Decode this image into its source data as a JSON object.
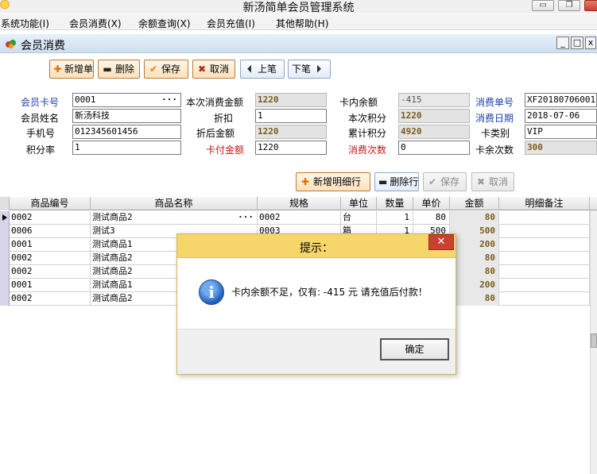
{
  "window": {
    "title": "新汤简单会员管理系统",
    "minimize": "▭",
    "restore": "❐",
    "close": "✕"
  },
  "menu": [
    "系统功能(I)",
    "会员消费(X)",
    "余额查询(X)",
    "会员充值(I)",
    "其他帮助(H)"
  ],
  "form": {
    "title": "会员消费",
    "min": "_",
    "max": "□",
    "close": "x"
  },
  "toolbar": {
    "new": "新增单",
    "delete": "删除",
    "save": "保存",
    "cancel": "取消",
    "prev": "上笔",
    "next": "下笔"
  },
  "fields": {
    "card_no_label": "会员卡号",
    "card_no": "0001",
    "name_label": "会员姓名",
    "name": "新汤科技",
    "phone_label": "手机号",
    "phone": "012345601456",
    "rate_label": "积分率",
    "rate": "1",
    "amount_label": "本次消费金额",
    "amount": "1220",
    "discount_label": "折扣",
    "discount": "1",
    "after_discount_label": "折后金额",
    "after_discount": "1220",
    "card_pay_label": "卡付金额",
    "card_pay": "1220",
    "balance_label": "卡内余额",
    "balance": "-415",
    "points_label": "本次积分",
    "points": "1220",
    "total_points_label": "累计积分",
    "total_points": "4920",
    "times_label": "消费次数",
    "times": "0",
    "bill_no_label": "消费单号",
    "bill_no": "XF20180706001",
    "date_label": "消费日期",
    "date": "2018-07-06",
    "card_type_label": "卡类别",
    "card_type": "VIP",
    "card_times_label": "卡余次数",
    "card_times": "300"
  },
  "detail_toolbar": {
    "add": "新增明细行",
    "delete": "删除行",
    "save": "保存",
    "cancel": "取消"
  },
  "table": {
    "headers": [
      "商品编号",
      "商品名称",
      "规格",
      "单位",
      "数量",
      "单价",
      "金额",
      "明细备注"
    ],
    "rows": [
      {
        "code": "0002",
        "name": "测试商品2",
        "spec": "0002",
        "unit": "台",
        "qty": "1",
        "price": "80",
        "amount": "80",
        "note": ""
      },
      {
        "code": "0006",
        "name": "测试3",
        "spec": "0003",
        "unit": "箱",
        "qty": "1",
        "price": "500",
        "amount": "500",
        "note": ""
      },
      {
        "code": "0001",
        "name": "测试商品1",
        "spec": "",
        "unit": "",
        "qty": "",
        "price": "",
        "amount": "200",
        "note": ""
      },
      {
        "code": "0002",
        "name": "测试商品2",
        "spec": "",
        "unit": "",
        "qty": "",
        "price": "",
        "amount": "80",
        "note": ""
      },
      {
        "code": "0002",
        "name": "测试商品2",
        "spec": "",
        "unit": "",
        "qty": "",
        "price": "",
        "amount": "80",
        "note": ""
      },
      {
        "code": "0001",
        "name": "测试商品1",
        "spec": "",
        "unit": "",
        "qty": "",
        "price": "",
        "amount": "200",
        "note": ""
      },
      {
        "code": "0002",
        "name": "测试商品2",
        "spec": "",
        "unit": "",
        "qty": "",
        "price": "",
        "amount": "80",
        "note": ""
      }
    ]
  },
  "dialog": {
    "title": "提示：",
    "close": "✕",
    "message": "卡内余额不足，仅有: -415 元 请充值后付款！",
    "ok": "确定",
    "icon": "i"
  },
  "colors": {
    "label_blue": "#1f3ea8",
    "label_red": "#c0191a",
    "dialog_title": "#f6d66b",
    "amount_text": "#7a5b1d"
  }
}
